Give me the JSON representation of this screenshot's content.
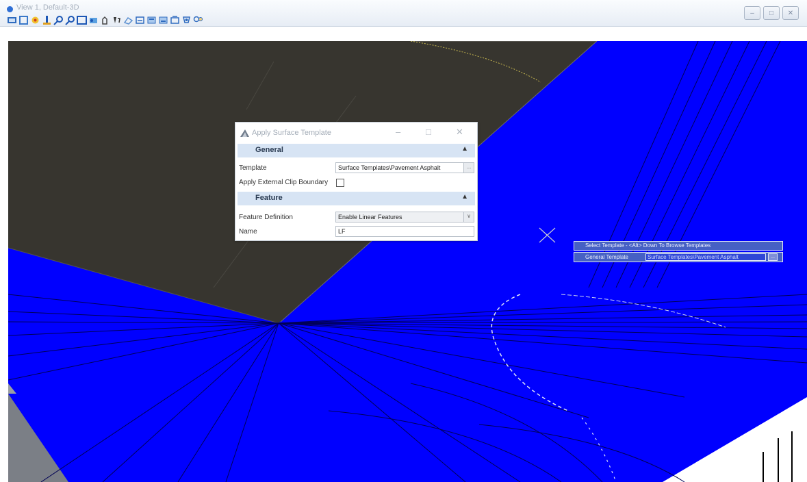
{
  "window": {
    "title": "View 1, Default-3D",
    "buttons": [
      "minimize-icon",
      "restore-icon",
      "close-icon"
    ]
  },
  "toolbar": {
    "icons": [
      "view-attributes-icon",
      "display-style-icon",
      "update-view-icon",
      "zoom-in-icon",
      "zoom-out-icon",
      "window-area-icon",
      "fit-view-icon",
      "rotate-view-icon",
      "pan-view-icon",
      "view-previous-icon",
      "view-next-icon",
      "copy-view-icon",
      "camera-icon",
      "clip-volume-icon",
      "clip-mask-icon",
      "walk-icon"
    ]
  },
  "dialog": {
    "title": "Apply Surface Template",
    "sections": {
      "general": {
        "label": "General",
        "template_label": "Template",
        "template_value": "Surface Templates\\Pavement Asphalt",
        "clip_label": "Apply External Clip Boundary",
        "clip_checked": false
      },
      "feature": {
        "label": "Feature",
        "feature_def_label": "Feature Definition",
        "feature_def_value": "Enable Linear Features",
        "name_label": "Name",
        "name_value": "LF"
      }
    }
  },
  "prompt": {
    "line1": "Select Template - <Alt> Down To Browse Templates",
    "field_label": "General Template",
    "field_value": "Surface Templates\\Pavement Asphalt",
    "button": "..."
  },
  "colors": {
    "surface_blue": "#0000ff",
    "pavement_dark": "#37352f",
    "prompt_blue": "#4660c4",
    "section_header": "#d7e4f4"
  }
}
